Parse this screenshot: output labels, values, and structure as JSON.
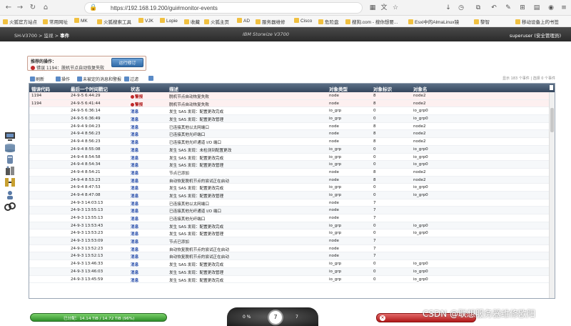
{
  "browser": {
    "url": "https://192.168.19.200/gui#monitor-events",
    "bookmarks": [
      "火狐官方站点",
      "常用网址",
      "MK",
      "火狐搜索工具",
      "VJK",
      "Lopie",
      "收藏",
      "火狐主页",
      "AD",
      "服务器维修",
      "Cisco",
      "危险盘",
      "搜狗.com - 搜你想要...",
      "Esxi中的AlmaLinux镜",
      "黎智",
      "移动设备上的书签"
    ]
  },
  "header": {
    "breadcrumb_system": "SH-V3700",
    "breadcrumb_section": "监视",
    "breadcrumb_page": "事件",
    "product": "IBM Storwize V3700",
    "user": "superuser (安全管理员)"
  },
  "recommended": {
    "title": "推荐的操作：",
    "error_text": "错误 1194：脱机节点自动恢复失败",
    "fix_button": "运行修订"
  },
  "toolbar": {
    "refresh": "刷新",
    "actions": "操作",
    "filter": "未被定的消息和警报",
    "search": "过滤",
    "rows_info": "显示 183 个事件 | 选择 0 个事件"
  },
  "table": {
    "columns": [
      "错误代码",
      "最后一个时间戳记",
      "状态",
      "描述",
      "对象类型",
      "对象标识",
      "对象名"
    ],
    "rows": [
      {
        "code": "1194",
        "ts": "24-9-5 6:44:29",
        "status": "警报",
        "desc": "脱机节点自动恢复失败",
        "otype": "node",
        "oid": "8",
        "oname": "node2",
        "kind": "err"
      },
      {
        "code": "1194",
        "ts": "24-9-5 6:41:44",
        "status": "警报",
        "desc": "脱机节点自动恢复失败",
        "otype": "node",
        "oid": "8",
        "oname": "node2",
        "kind": "err"
      },
      {
        "code": "",
        "ts": "24-9-5 6:36:14",
        "status": "消息",
        "desc": "发生 SAS 发现：配置更改完成",
        "otype": "io_grp",
        "oid": "0",
        "oname": "io_grp0",
        "kind": "info"
      },
      {
        "code": "",
        "ts": "24-9-5 6:36:49",
        "status": "消息",
        "desc": "发生 SAS 发现：配置更改管理",
        "otype": "io_grp",
        "oid": "0",
        "oname": "io_grp0",
        "kind": "info"
      },
      {
        "code": "",
        "ts": "24-9-4 9:04:23",
        "status": "消息",
        "desc": "已连接其他以太网端口",
        "otype": "node",
        "oid": "8",
        "oname": "node2",
        "kind": "info"
      },
      {
        "code": "",
        "ts": "24-9-4 8:56:23",
        "status": "消息",
        "desc": "已连接其他光纤端口",
        "otype": "node",
        "oid": "8",
        "oname": "node2",
        "kind": "info"
      },
      {
        "code": "",
        "ts": "24-9-4 8:56:23",
        "status": "消息",
        "desc": "已连接其他光纤通道 I/O 端口",
        "otype": "node",
        "oid": "8",
        "oname": "node2",
        "kind": "info"
      },
      {
        "code": "",
        "ts": "24-9-4 8:55:08",
        "status": "消息",
        "desc": "发生 SAS 发现：未检测到配置更改",
        "otype": "io_grp",
        "oid": "0",
        "oname": "io_grp0",
        "kind": "info"
      },
      {
        "code": "",
        "ts": "24-9-4 8:54:58",
        "status": "消息",
        "desc": "发生 SAS 发现：配置更改完成",
        "otype": "io_grp",
        "oid": "0",
        "oname": "io_grp0",
        "kind": "info"
      },
      {
        "code": "",
        "ts": "24-9-4 8:54:34",
        "status": "消息",
        "desc": "发生 SAS 发现：配置更改管理",
        "otype": "io_grp",
        "oid": "0",
        "oname": "io_grp0",
        "kind": "info"
      },
      {
        "code": "",
        "ts": "24-9-4 8:54:21",
        "status": "消息",
        "desc": "节点已添加",
        "otype": "node",
        "oid": "8",
        "oname": "node2",
        "kind": "info"
      },
      {
        "code": "",
        "ts": "24-9-4 8:53:23",
        "status": "消息",
        "desc": "自动恢复脱机节点的尝试正在启动",
        "otype": "node",
        "oid": "8",
        "oname": "node2",
        "kind": "info"
      },
      {
        "code": "",
        "ts": "24-9-4 8:47:53",
        "status": "消息",
        "desc": "发生 SAS 发现：配置更改完成",
        "otype": "io_grp",
        "oid": "0",
        "oname": "io_grp0",
        "kind": "info"
      },
      {
        "code": "",
        "ts": "24-9-4 8:47:08",
        "status": "消息",
        "desc": "发生 SAS 发现：配置更改管理",
        "otype": "io_grp",
        "oid": "0",
        "oname": "io_grp0",
        "kind": "info"
      },
      {
        "code": "",
        "ts": "24-9-3 14:03:13",
        "status": "消息",
        "desc": "已连接其他以太网端口",
        "otype": "node",
        "oid": "7",
        "oname": "",
        "kind": "info"
      },
      {
        "code": "",
        "ts": "24-9-3 13:55:13",
        "status": "消息",
        "desc": "已连接其他光纤通道 I/O 端口",
        "otype": "node",
        "oid": "7",
        "oname": "",
        "kind": "info"
      },
      {
        "code": "",
        "ts": "24-9-3 13:55:13",
        "status": "消息",
        "desc": "已连接其他光纤端口",
        "otype": "node",
        "oid": "7",
        "oname": "",
        "kind": "info"
      },
      {
        "code": "",
        "ts": "24-9-3 13:53:43",
        "status": "消息",
        "desc": "发生 SAS 发现：配置更改完成",
        "otype": "io_grp",
        "oid": "0",
        "oname": "io_grp0",
        "kind": "info"
      },
      {
        "code": "",
        "ts": "24-9-3 13:53:23",
        "status": "消息",
        "desc": "发生 SAS 发现：配置更改管理",
        "otype": "io_grp",
        "oid": "0",
        "oname": "io_grp0",
        "kind": "info"
      },
      {
        "code": "",
        "ts": "24-9-3 13:53:09",
        "status": "消息",
        "desc": "节点已添加",
        "otype": "node",
        "oid": "7",
        "oname": "",
        "kind": "info"
      },
      {
        "code": "",
        "ts": "24-9-3 13:52:23",
        "status": "消息",
        "desc": "自动恢复脱机节点的尝试正在启动",
        "otype": "node",
        "oid": "7",
        "oname": "",
        "kind": "info"
      },
      {
        "code": "",
        "ts": "24-9-3 13:52:13",
        "status": "消息",
        "desc": "自动恢复脱机节点的尝试正在启动",
        "otype": "node",
        "oid": "7",
        "oname": "",
        "kind": "info"
      },
      {
        "code": "",
        "ts": "24-9-3 13:46:33",
        "status": "消息",
        "desc": "发生 SAS 发现：配置更改完成",
        "otype": "io_grp",
        "oid": "0",
        "oname": "io_grp0",
        "kind": "info"
      },
      {
        "code": "",
        "ts": "24-9-3 13:46:03",
        "status": "消息",
        "desc": "发生 SAS 发现：配置更改管理",
        "otype": "io_grp",
        "oid": "0",
        "oname": "io_grp0",
        "kind": "info"
      },
      {
        "code": "",
        "ts": "24-9-3 13:45:59",
        "status": "消息",
        "desc": "发生 SAS 发现：配置更改完成",
        "otype": "io_grp",
        "oid": "0",
        "oname": "io_grp0",
        "kind": "info"
      }
    ]
  },
  "status": {
    "capacity": "已分配：14.14 TiB / 14.72 TiB (96%)",
    "left_value": "0 %",
    "center_value": "7",
    "right_value": "7"
  },
  "watermark": "CSDN @联想服务器维修欧阳",
  "colors": {
    "header_dark": "#2a2a2a",
    "table_header": "#34465d",
    "info": "#2148a8",
    "error": "#b01b1b",
    "capacity": "#2f8f2a"
  }
}
